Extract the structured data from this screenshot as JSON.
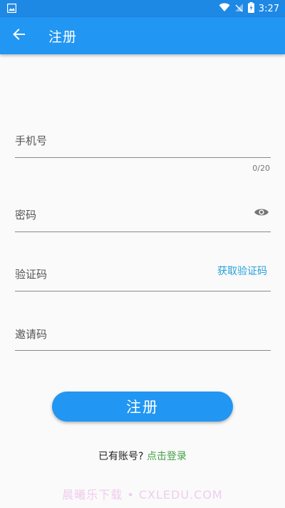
{
  "status_bar": {
    "time": "3:27",
    "icons": [
      "image-icon",
      "wifi-icon",
      "no-signal-icon",
      "battery-charging-icon"
    ]
  },
  "app_bar": {
    "title": "注册",
    "back_icon": "arrow-left-icon"
  },
  "form": {
    "phone": {
      "label": "手机号",
      "value": "",
      "counter": "0/20"
    },
    "password": {
      "label": "密码",
      "value": "",
      "toggle_icon": "eye-icon"
    },
    "code": {
      "label": "验证码",
      "value": "",
      "action": "获取验证码"
    },
    "invite": {
      "label": "邀请码",
      "value": ""
    }
  },
  "submit_label": "注册",
  "login_prompt": {
    "question": "已有账号?",
    "link": "点击登录"
  },
  "watermark": "晨曦乐下载 • CXLEDU.COM",
  "colors": {
    "primary": "#2196f3",
    "status_bar": "#1e88e5",
    "accent_link": "#26a0da",
    "login_link": "#43a047"
  }
}
